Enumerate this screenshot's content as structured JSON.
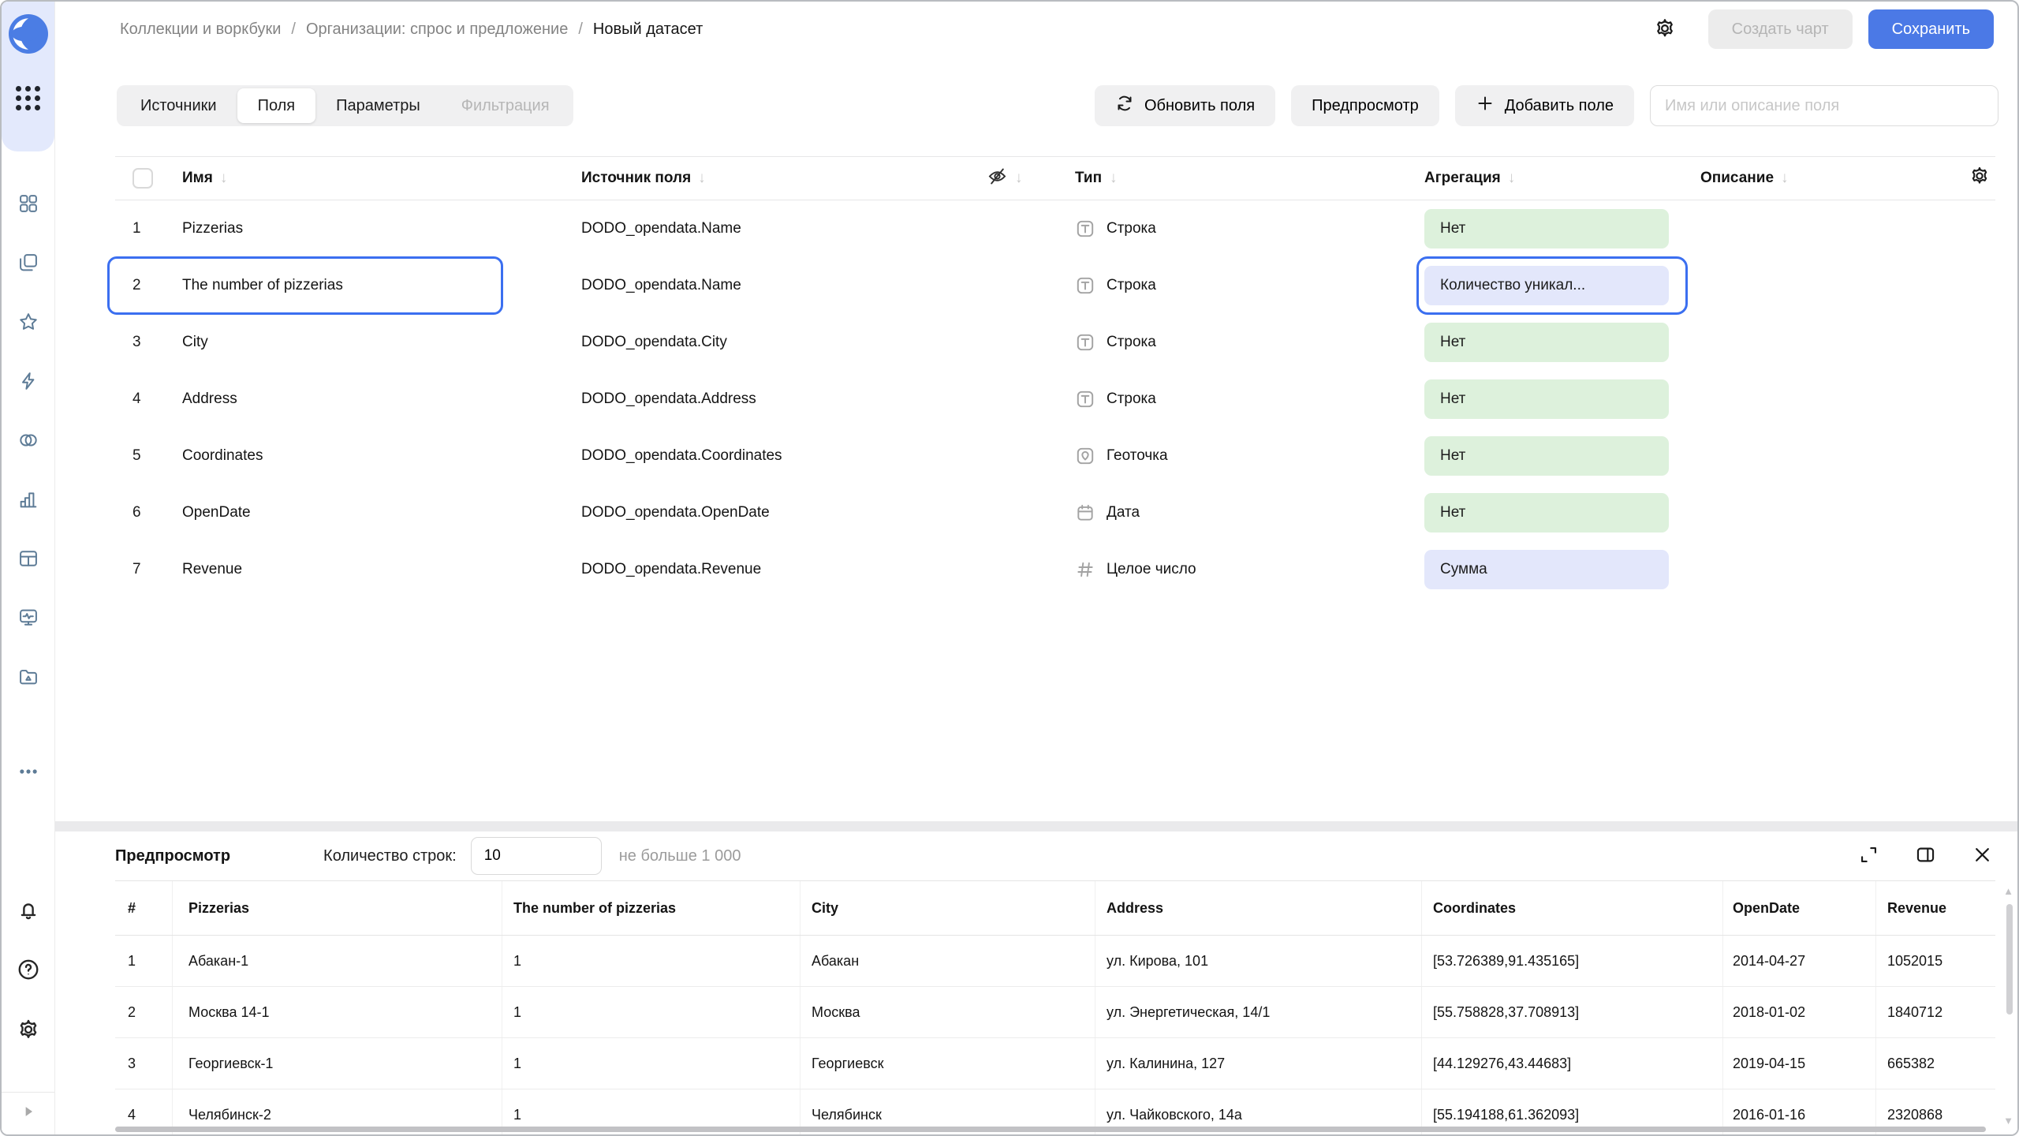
{
  "colors": {
    "primary_blue": "#4b79e6",
    "selection_blue": "#3b6ff0",
    "pill_green_bg": "#ddf1dc",
    "pill_purple_bg": "#e3e7fb",
    "sidebar_top_bg": "#e3e9fc"
  },
  "sidebar": {
    "icons": [
      "datalens-logo",
      "apps-grid-icon",
      "collections-icon",
      "workbooks-icon",
      "star-icon",
      "lightning-icon",
      "relations-icon",
      "charts-icon",
      "table-icon",
      "monitoring-icon",
      "storage-folder-icon",
      "more-ellipsis-icon",
      "bell-icon",
      "help-icon",
      "settings-icon",
      "expand-sidebar-icon"
    ]
  },
  "header": {
    "breadcrumb": [
      {
        "label": "Коллекции и воркбуки"
      },
      {
        "label": "Организации: спрос и предложение"
      },
      {
        "label": "Новый датасет"
      }
    ],
    "separator": "/",
    "create_chart_label": "Создать чарт",
    "save_label": "Сохранить"
  },
  "toolbar": {
    "tabs": [
      {
        "label": "Источники"
      },
      {
        "label": "Поля"
      },
      {
        "label": "Параметры"
      },
      {
        "label": "Фильтрация"
      }
    ],
    "refresh_fields_label": "Обновить поля",
    "preview_label": "Предпросмотр",
    "add_field_label": "Добавить поле",
    "search_placeholder": "Имя или описание поля"
  },
  "fields_table": {
    "sort_arrow": "↓",
    "headers": {
      "name": "Имя",
      "source": "Источник поля",
      "type": "Тип",
      "aggregation": "Агрегация",
      "description": "Описание"
    },
    "rows": [
      {
        "num": "1",
        "name": "Pizzerias",
        "source": "DODO_opendata.Name",
        "type": "Строка",
        "aggregation": "Нет",
        "agg_color": "green",
        "selected": false
      },
      {
        "num": "2",
        "name": "The number of pizzerias",
        "source": "DODO_opendata.Name",
        "type": "Строка",
        "aggregation": "Количество уникал...",
        "agg_color": "purple",
        "selected": true
      },
      {
        "num": "3",
        "name": "City",
        "source": "DODO_opendata.City",
        "type": "Строка",
        "aggregation": "Нет",
        "agg_color": "green",
        "selected": false
      },
      {
        "num": "4",
        "name": "Address",
        "source": "DODO_opendata.Address",
        "type": "Строка",
        "aggregation": "Нет",
        "agg_color": "green",
        "selected": false
      },
      {
        "num": "5",
        "name": "Coordinates",
        "source": "DODO_opendata.Coordinates",
        "type": "Геоточка",
        "aggregation": "Нет",
        "agg_color": "green",
        "selected": false
      },
      {
        "num": "6",
        "name": "OpenDate",
        "source": "DODO_opendata.OpenDate",
        "type": "Дата",
        "aggregation": "Нет",
        "agg_color": "green",
        "selected": false
      },
      {
        "num": "7",
        "name": "Revenue",
        "source": "DODO_opendata.Revenue",
        "type": "Целое число",
        "aggregation": "Сумма",
        "agg_color": "purple",
        "selected": false
      }
    ]
  },
  "preview": {
    "title": "Предпросмотр",
    "row_count_label": "Количество строк:",
    "row_count_value": "10",
    "row_count_hint": "не больше 1 000",
    "table": {
      "columns": [
        "#",
        "Pizzerias",
        "The number of pizzerias",
        "City",
        "Address",
        "Coordinates",
        "OpenDate",
        "Revenue"
      ],
      "rows": [
        [
          "1",
          "Абакан-1",
          "1",
          "Абакан",
          "ул. Кирова, 101",
          "[53.726389,91.435165]",
          "2014-04-27",
          "1052015"
        ],
        [
          "2",
          "Москва 14-1",
          "1",
          "Москва",
          "ул. Энергетическая, 14/1",
          "[55.758828,37.708913]",
          "2018-01-02",
          "1840712"
        ],
        [
          "3",
          "Георгиевск-1",
          "1",
          "Георгиевск",
          "ул. Калинина, 127",
          "[44.129276,43.44683]",
          "2019-04-15",
          "665382"
        ],
        [
          "4",
          "Челябинск-2",
          "1",
          "Челябинск",
          "ул. Чайковского, 14а",
          "[55.194188,61.362093]",
          "2016-01-16",
          "2320868"
        ]
      ]
    }
  }
}
